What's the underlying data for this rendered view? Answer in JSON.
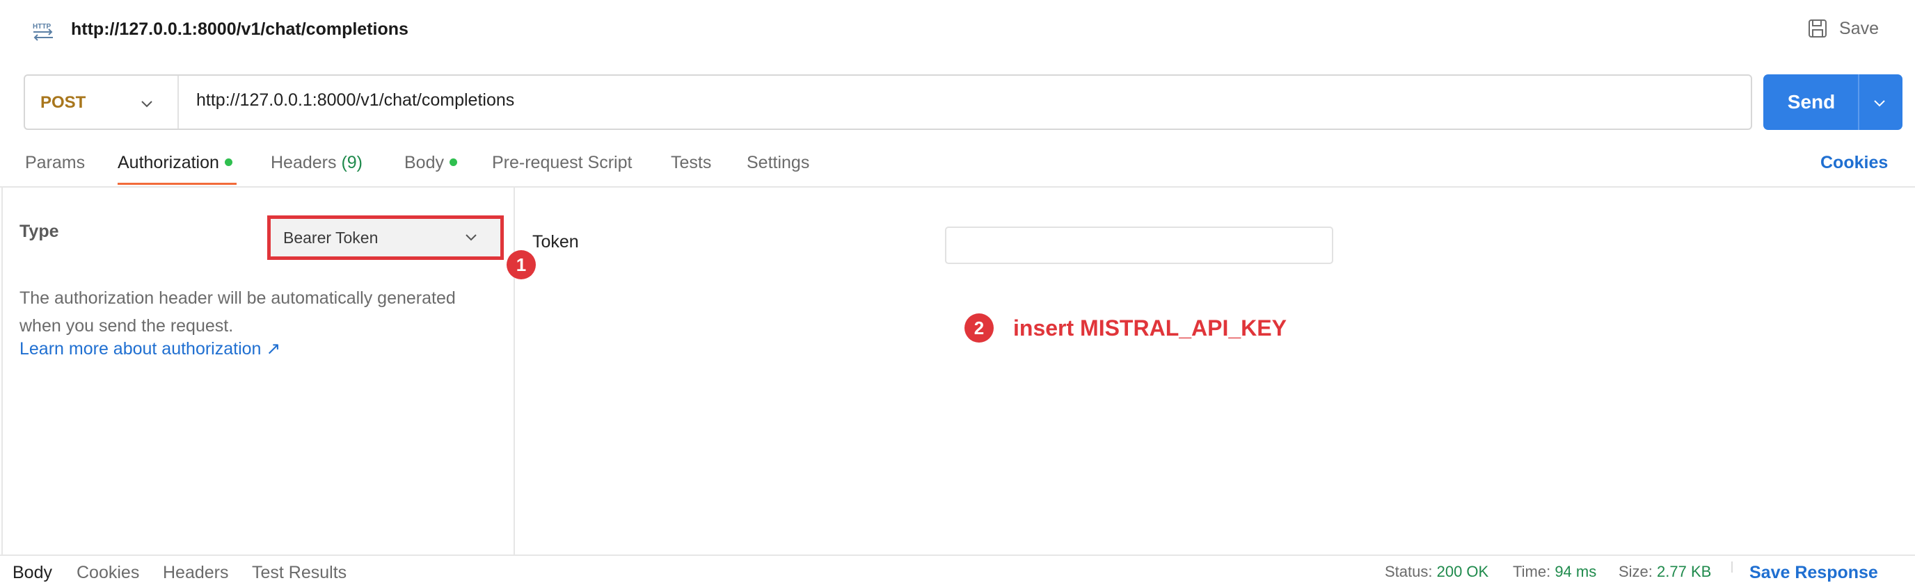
{
  "header": {
    "icon": "http-icon",
    "title": "http://127.0.0.1:8000/v1/chat/completions",
    "save_label": "Save"
  },
  "request": {
    "method": "POST",
    "url": "http://127.0.0.1:8000/v1/chat/completions",
    "send_label": "Send"
  },
  "tabs": {
    "items": [
      {
        "label": "Params"
      },
      {
        "label": "Authorization",
        "dot": true,
        "active": true
      },
      {
        "label": "Headers",
        "count": "(9)"
      },
      {
        "label": "Body",
        "dot": true
      },
      {
        "label": "Pre-request Script"
      },
      {
        "label": "Tests"
      },
      {
        "label": "Settings"
      }
    ],
    "cookies_label": "Cookies"
  },
  "auth": {
    "type_label": "Type",
    "type_value": "Bearer Token",
    "description": "The authorization header will be automatically generated when you send the request.",
    "learn_more": "Learn more about authorization ↗",
    "token_label": "Token",
    "token_value": ""
  },
  "annotations": {
    "badge_1": "1",
    "badge_2": "2",
    "note": "insert MISTRAL_API_KEY",
    "color": "#e0353a"
  },
  "response_bar": {
    "tabs": [
      {
        "label": "Body",
        "active": true
      },
      {
        "label": "Cookies"
      },
      {
        "label": "Headers"
      },
      {
        "label": "Test Results"
      }
    ],
    "status_label": "Status:",
    "status_value": "200 OK",
    "time_label": "Time:",
    "time_value": "94 ms",
    "size_label": "Size:",
    "size_value": "2.77 KB",
    "save_response": "Save Response"
  },
  "colors": {
    "accent_blue": "#2f7fe5",
    "link_blue": "#1f6fd1",
    "method_post": "#a8761c",
    "active_tab_underline": "#f26b3a",
    "dot_green": "#2fbf4f"
  }
}
